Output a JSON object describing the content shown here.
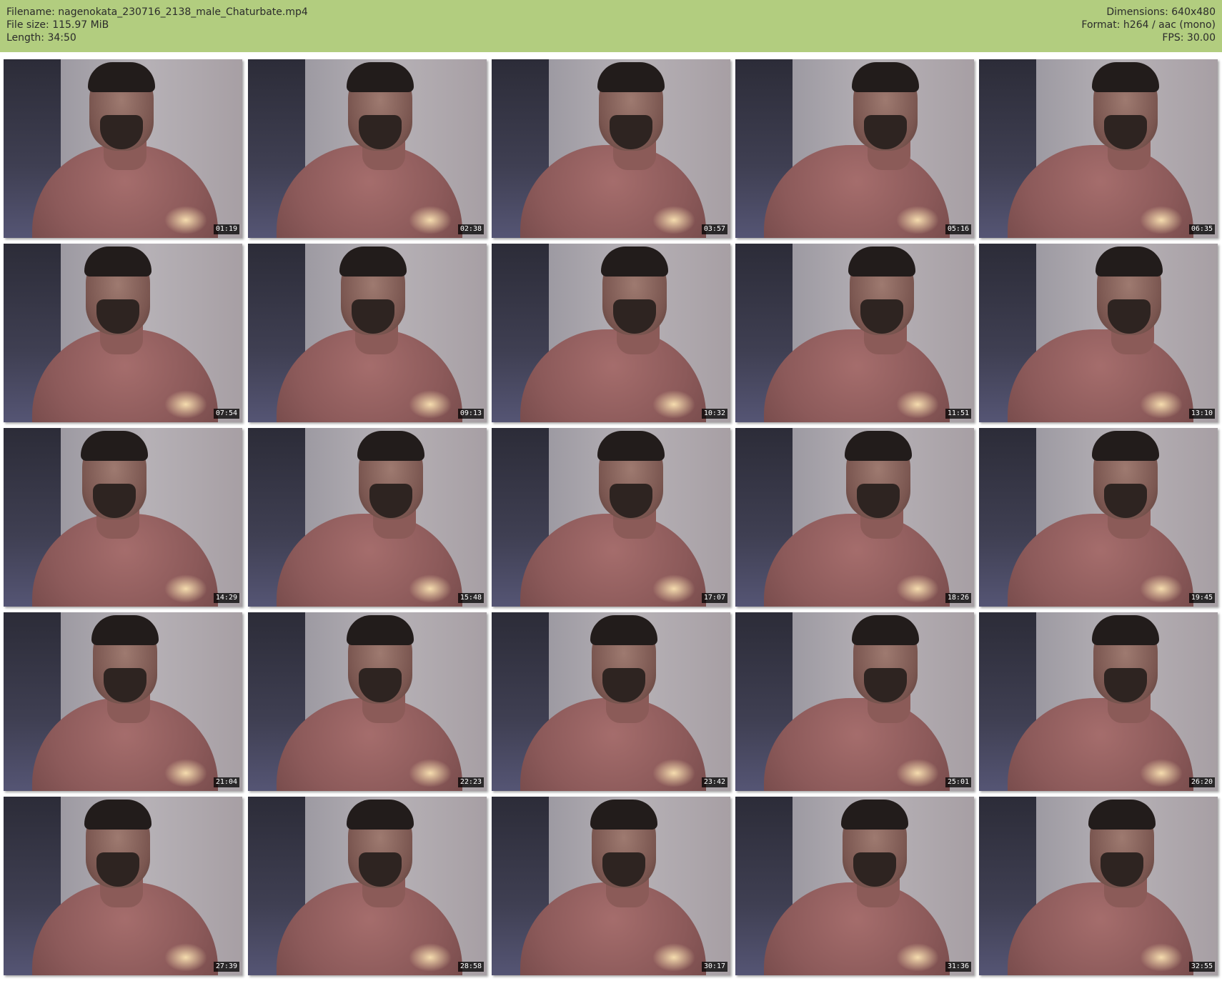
{
  "header": {
    "filename_line": "Filename: nagenokata_230716_2138_male_Chaturbate.mp4",
    "filesize_line": "File size: 115.97 MiB",
    "length_line": "Length: 34:50",
    "dimensions_line": "Dimensions: 640x480",
    "format_line": "Format: h264 / aac (mono)",
    "fps_line": "FPS: 30.00",
    "background_color": "#b2cd7f"
  },
  "thumbnails": [
    {
      "timestamp": "01:19"
    },
    {
      "timestamp": "02:38"
    },
    {
      "timestamp": "03:57"
    },
    {
      "timestamp": "05:16"
    },
    {
      "timestamp": "06:35"
    },
    {
      "timestamp": "07:54"
    },
    {
      "timestamp": "09:13"
    },
    {
      "timestamp": "10:32"
    },
    {
      "timestamp": "11:51"
    },
    {
      "timestamp": "13:10"
    },
    {
      "timestamp": "14:29"
    },
    {
      "timestamp": "15:48"
    },
    {
      "timestamp": "17:07"
    },
    {
      "timestamp": "18:26"
    },
    {
      "timestamp": "19:45"
    },
    {
      "timestamp": "21:04"
    },
    {
      "timestamp": "22:23"
    },
    {
      "timestamp": "23:42"
    },
    {
      "timestamp": "25:01"
    },
    {
      "timestamp": "26:20"
    },
    {
      "timestamp": "27:39"
    },
    {
      "timestamp": "28:58"
    },
    {
      "timestamp": "30:17"
    },
    {
      "timestamp": "31:36"
    },
    {
      "timestamp": "32:55"
    }
  ]
}
